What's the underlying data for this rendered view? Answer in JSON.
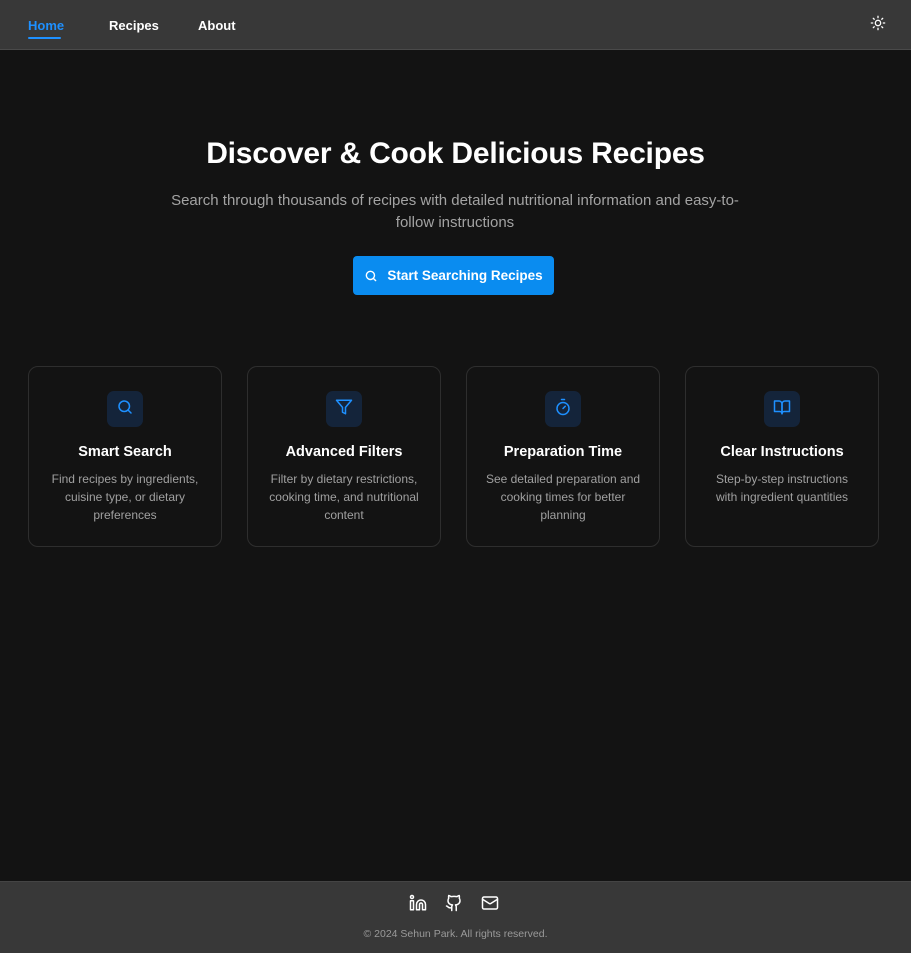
{
  "nav": {
    "items": [
      {
        "label": "Home",
        "active": true
      },
      {
        "label": "Recipes",
        "active": false
      },
      {
        "label": "About",
        "active": false
      }
    ],
    "theme_toggle_icon": "sun-icon"
  },
  "hero": {
    "title": "Discover & Cook Delicious Recipes",
    "subtitle": "Search through thousands of recipes with detailed nutritional information and easy-to-follow instructions",
    "cta_label": "Start Searching Recipes",
    "cta_icon": "search-icon"
  },
  "features": [
    {
      "icon": "search-icon",
      "title": "Smart Search",
      "description": "Find recipes by ingredients, cuisine type, or dietary preferences"
    },
    {
      "icon": "filter-icon",
      "title": "Advanced Filters",
      "description": "Filter by dietary restrictions, cooking time, and nutritional content"
    },
    {
      "icon": "timer-icon",
      "title": "Preparation Time",
      "description": "See detailed preparation and cooking times for better planning"
    },
    {
      "icon": "book-open-icon",
      "title": "Clear Instructions",
      "description": "Step-by-step instructions with ingredient quantities"
    }
  ],
  "footer": {
    "social": [
      {
        "icon": "linkedin-icon"
      },
      {
        "icon": "github-icon"
      },
      {
        "icon": "mail-icon"
      }
    ],
    "copyright": "© 2024 Sehun Park. All rights reserved."
  },
  "colors": {
    "accent": "#1e90ff",
    "button": "#0a8cf0",
    "background": "#131313",
    "navbar": "#383838",
    "card_border": "#2e2e2e",
    "icon_tile": "#14243a"
  }
}
